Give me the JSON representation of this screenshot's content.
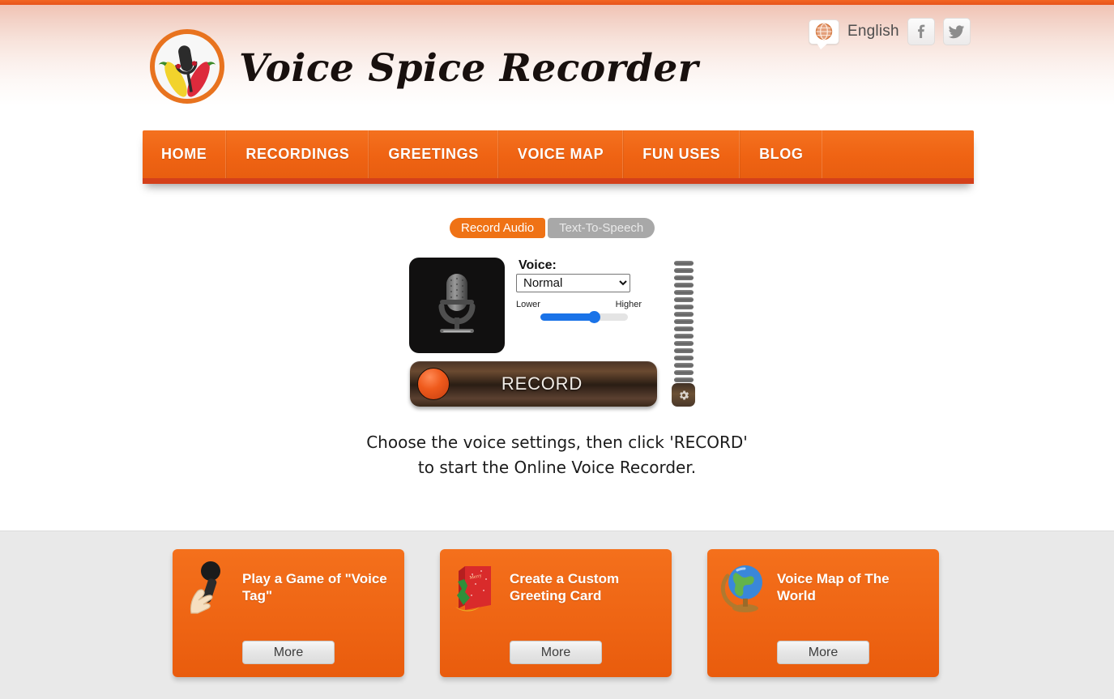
{
  "site": {
    "title": "Voice Spice Recorder",
    "logo_icon": "chili-microphone-logo-icon"
  },
  "utility": {
    "globe_icon": "globe-icon",
    "language": "English",
    "facebook_icon": "facebook-icon",
    "facebook_glyph": "f",
    "twitter_icon": "twitter-icon",
    "twitter_glyph": "🐦"
  },
  "nav": {
    "items": [
      {
        "label": "HOME"
      },
      {
        "label": "RECORDINGS"
      },
      {
        "label": "GREETINGS"
      },
      {
        "label": "VOICE MAP"
      },
      {
        "label": "FUN USES"
      },
      {
        "label": "BLOG"
      }
    ]
  },
  "tabs": [
    {
      "label": "Record Audio",
      "active": true
    },
    {
      "label": "Text-To-Speech",
      "active": false
    }
  ],
  "recorder": {
    "mic_icon": "microphone-icon",
    "voice_label": "Voice:",
    "voice_selected": "Normal",
    "voice_options": [
      "Normal"
    ],
    "pitch_low_label": "Lower",
    "pitch_high_label": "Higher",
    "pitch_percent": 62,
    "record_label": "RECORD",
    "record_dot_icon": "record-dot-icon",
    "gear_icon": "gear-icon",
    "vu_bar_count": 17
  },
  "instructions": {
    "line1": "Choose the voice settings, then click 'RECORD'",
    "line2": "to start the Online Voice Recorder."
  },
  "promo": {
    "cards": [
      {
        "title": "Play a Game of \"Voice Tag\"",
        "icon": "hand-holding-microphone-icon",
        "button": "More"
      },
      {
        "title": "Create a Custom Greeting Card",
        "icon": "greeting-card-icon",
        "button": "More"
      },
      {
        "title": "Voice Map of The World",
        "icon": "globe-stand-icon",
        "button": "More"
      }
    ]
  },
  "colors": {
    "brand_orange": "#ef6313",
    "nav_underline": "#d4401a",
    "slider_blue": "#1a73e8",
    "promo_bg": "#e9e9e9"
  }
}
